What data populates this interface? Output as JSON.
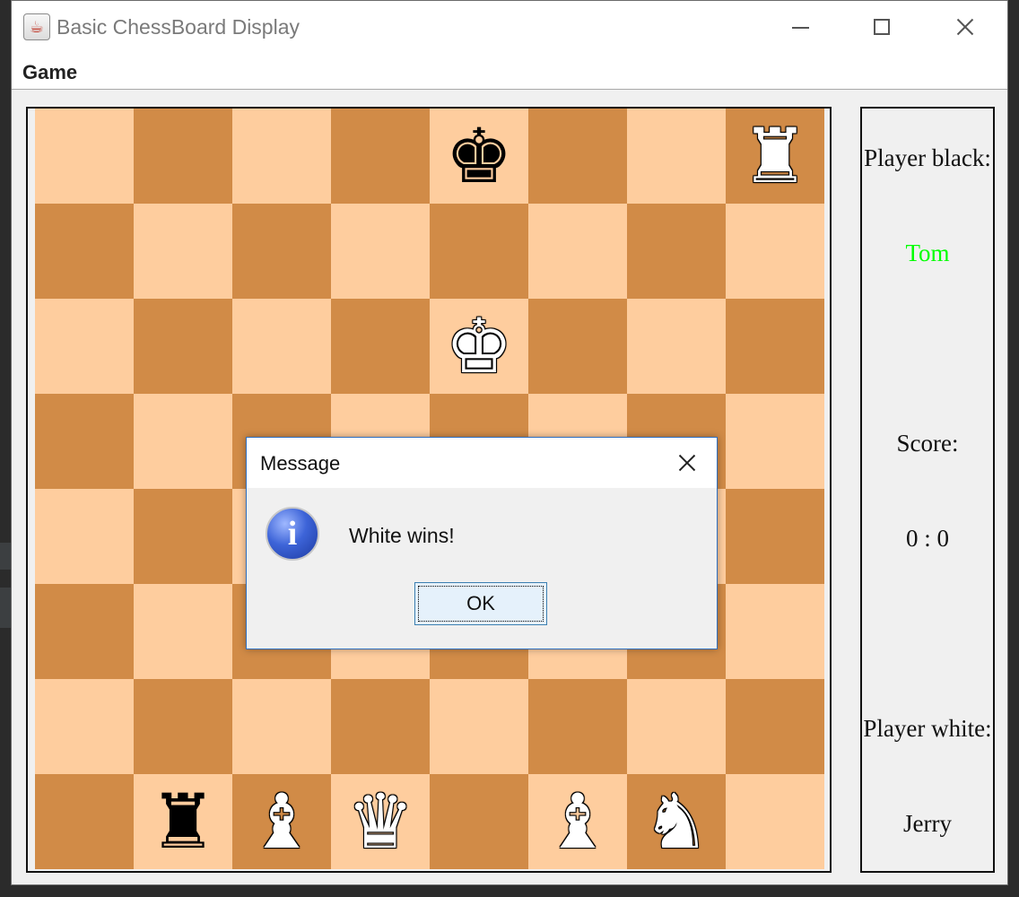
{
  "window": {
    "title": "Basic ChessBoard Display",
    "app_icon": "java-cup-icon"
  },
  "menu": {
    "items": [
      "Game"
    ]
  },
  "board": {
    "light_color": "#fecd9e",
    "dark_color": "#d18b47",
    "rows": [
      [
        null,
        null,
        null,
        null,
        {
          "glyph": "♚",
          "color": "black",
          "name": "black-king"
        },
        null,
        null,
        {
          "glyph": "♜",
          "color": "white",
          "name": "white-rook"
        }
      ],
      [
        null,
        null,
        null,
        null,
        null,
        null,
        null,
        null
      ],
      [
        null,
        null,
        null,
        null,
        {
          "glyph": "♚",
          "color": "white",
          "name": "white-king"
        },
        null,
        null,
        null
      ],
      [
        null,
        null,
        null,
        null,
        null,
        null,
        null,
        null
      ],
      [
        null,
        null,
        null,
        null,
        null,
        null,
        null,
        null
      ],
      [
        null,
        null,
        null,
        null,
        null,
        null,
        null,
        null
      ],
      [
        null,
        null,
        null,
        null,
        null,
        null,
        null,
        null
      ],
      [
        null,
        {
          "glyph": "♜",
          "color": "black",
          "name": "black-rook"
        },
        {
          "glyph": "♝",
          "color": "white",
          "name": "white-bishop"
        },
        {
          "glyph": "♛",
          "color": "white",
          "name": "white-queen"
        },
        null,
        {
          "glyph": "♝",
          "color": "white",
          "name": "white-bishop"
        },
        {
          "glyph": "♞",
          "color": "white",
          "name": "white-knight"
        },
        null
      ]
    ]
  },
  "side_panel": {
    "player_black_label": "Player black:",
    "player_black_name": "Tom",
    "player_black_name_color": "#00ff00",
    "score_label": "Score:",
    "score_value": "0 : 0",
    "player_white_label": "Player white:",
    "player_white_name": "Jerry"
  },
  "dialog": {
    "title": "Message",
    "icon": "info-icon",
    "message": "White wins!",
    "ok_label": "OK"
  }
}
